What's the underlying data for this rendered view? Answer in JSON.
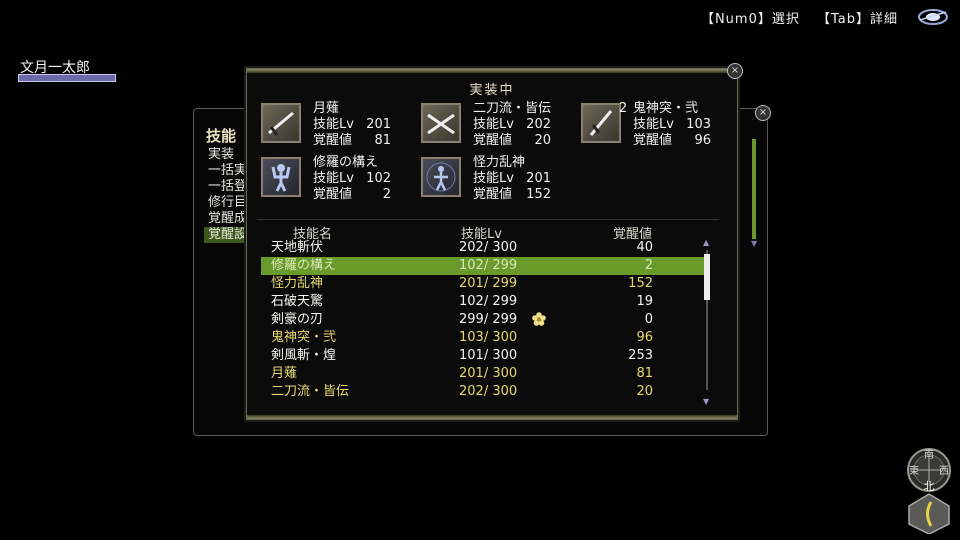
{
  "hud": {
    "hint1": "【Num0】選択",
    "hint2": "【Tab】詳細"
  },
  "character": {
    "name": "文月一太郎"
  },
  "background_panel": {
    "title": "技能",
    "menu": [
      "実装",
      "一括実",
      "一括登",
      "修行目",
      "覚醒成",
      "覚醒設"
    ]
  },
  "dialog": {
    "title": "実装中",
    "labels": {
      "lv": "技能Lv",
      "awk": "覚醒値"
    },
    "equipped": [
      {
        "name": "月薙",
        "lv": "201",
        "awk": "81",
        "icon": "single-sword-icon"
      },
      {
        "name": "二刀流・皆伝",
        "lv": "202",
        "awk": "20",
        "icon": "dual-swords-icon"
      },
      {
        "name": "鬼神突・弐",
        "lv": "103",
        "awk": "96",
        "icon": "sword-thrust-icon",
        "prefix": "2"
      },
      {
        "name": "修羅の構え",
        "lv": "102",
        "awk": "2",
        "icon": "stance-figure-icon"
      },
      {
        "name": "怪力乱神",
        "lv": "201",
        "awk": "152",
        "icon": "aura-figure-icon"
      }
    ],
    "columns": {
      "name": "技能名",
      "lv": "技能Lv",
      "awk": "覚醒値"
    },
    "skills": [
      {
        "name": "天地斬伏",
        "lv": "202/ 300",
        "awk": "40",
        "style": "white"
      },
      {
        "name": "修羅の構え",
        "lv": "102/ 299",
        "awk": "2",
        "style": "sel"
      },
      {
        "name": "怪力乱神",
        "lv": "201/ 299",
        "awk": "152",
        "style": "yellow"
      },
      {
        "name": "石破天驚",
        "lv": "102/ 299",
        "awk": "19",
        "style": "white"
      },
      {
        "name": "剣豪の刃",
        "lv": "299/ 299",
        "awk": "0",
        "style": "white",
        "flower": true
      },
      {
        "name": "鬼神突・弐",
        "lv": "103/ 300",
        "awk": "96",
        "style": "yellow"
      },
      {
        "name": "剣風斬・煌",
        "lv": "101/ 300",
        "awk": "253",
        "style": "white"
      },
      {
        "name": "月薙",
        "lv": "201/ 300",
        "awk": "81",
        "style": "yellow"
      },
      {
        "name": "二刀流・皆伝",
        "lv": "202/ 300",
        "awk": "20",
        "style": "yellow"
      }
    ]
  },
  "compass": {
    "n": "北",
    "s": "南",
    "e": "東",
    "w": "西"
  },
  "colors": {
    "selected_row": "#6a9a2a",
    "equipped_text": "#e8d870",
    "normal_text": "#f4f4f0"
  }
}
